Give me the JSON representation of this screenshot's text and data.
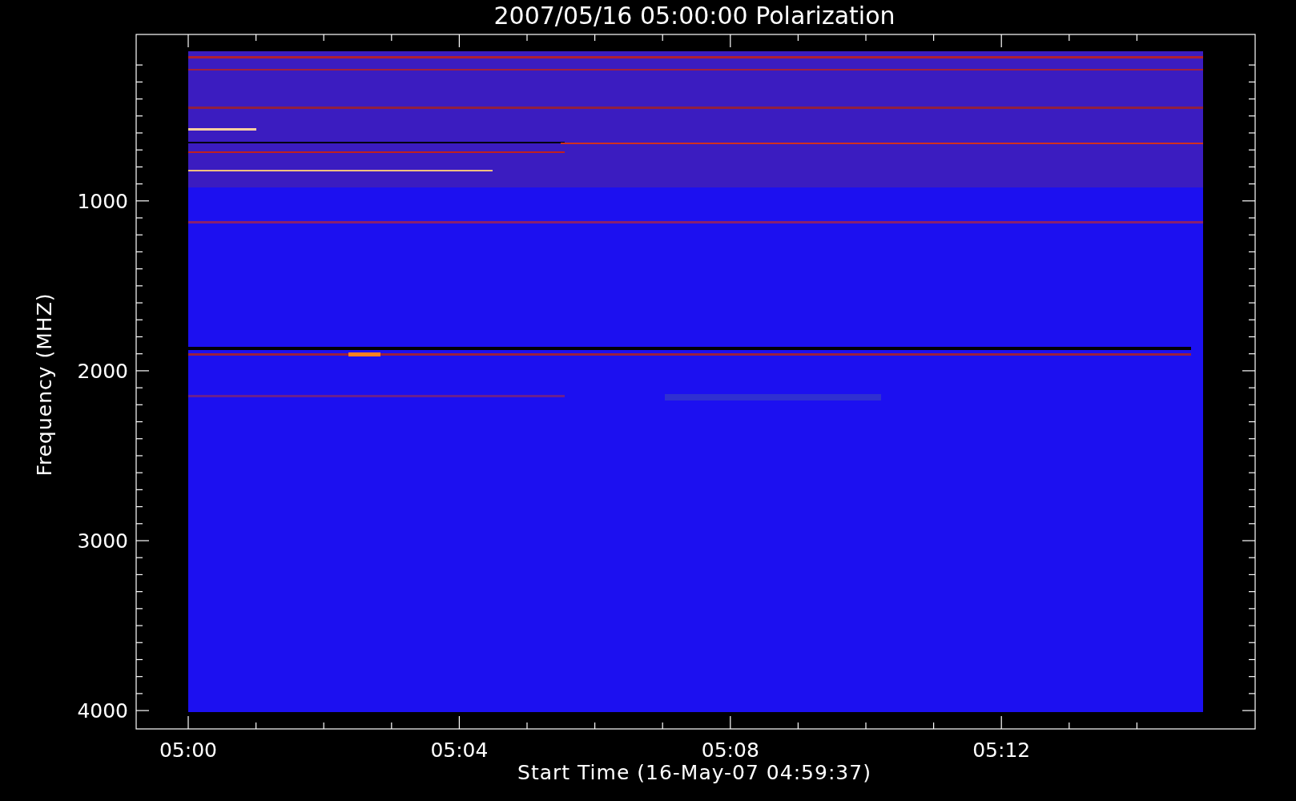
{
  "title": "2007/05/16 05:00:00 Polarization",
  "x_axis": {
    "label": "Start Time (16-May-07 04:59:37)",
    "tick_labels": [
      "05:00",
      "05:04",
      "05:08",
      "05:12"
    ]
  },
  "y_axis": {
    "label": "Frequency (MHZ)",
    "tick_labels": [
      "1000",
      "2000",
      "3000",
      "4000"
    ]
  }
}
